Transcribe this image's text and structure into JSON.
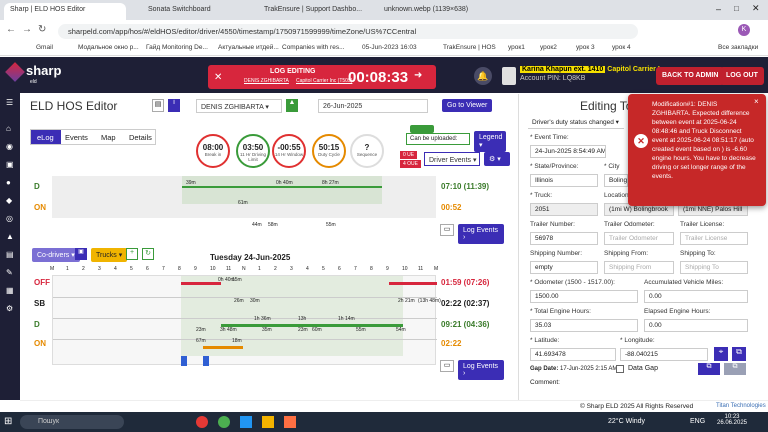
{
  "browser": {
    "tabs": [
      {
        "label": "Sharp | ELD HOS Editor"
      },
      {
        "label": "Sonata Switchboard"
      },
      {
        "label": "TrakEnsure | Support Dashbo..."
      },
      {
        "label": "unknown.webp (1139×638)"
      }
    ],
    "url": "sharpeld.com/app/hos/#/eldHOS/editor/driver/4550/timestamp/1750971599999/timeZone/US%7CCentral",
    "bookmarks": [
      "Gmail",
      "Модальное окно р...",
      "Гайд Monitoring De...",
      "Актуальные итдей...",
      "Companies with res...",
      "05-Jun-2023 16:03",
      "TrakEnsure | HOS",
      "урок1",
      "урок2",
      "урок 3",
      "урок 4",
      "Все закладки"
    ]
  },
  "header": {
    "logo": "sharp",
    "logo_sub": "eld",
    "edit_title": "LOG EDITING",
    "edit_company": "DENIS ZGHIBARTA",
    "edit_carrier": "Capitol Carrier Inc (T505)",
    "timer": "00:08:33",
    "user_highlight": "Karina Khapun ext. 1410",
    "carrier": "Capitol Carrier Inc",
    "account_pin": "Account PIN: LQ8KB",
    "back_admin": "BACK TO ADMIN",
    "logout": "LOG OUT"
  },
  "editor": {
    "title": "ELD HOS Editor",
    "driver": "DENIS ZGHIBARTA",
    "date": "26-Jun-2025",
    "go_viewer": "Go to Viewer",
    "tabs": [
      "eLog",
      "Events",
      "Map",
      "Details"
    ],
    "circles": [
      {
        "value": "08:00",
        "label": "Break in"
      },
      {
        "value": "03:50",
        "label": "11 Hr Driving Limit"
      },
      {
        "value": "-00:55",
        "label": "14 Hr Window"
      },
      {
        "value": "50:15",
        "label": "Duty Cycle"
      },
      {
        "value": "?",
        "label": "Sequence"
      }
    ],
    "can_upload": "Can be uploaded:",
    "legend": "Legend",
    "driver_events": "Driver Events",
    "badges": [
      "0 UE",
      "4 OUE"
    ],
    "top_rows": [
      {
        "label": "D",
        "total": "07:10 (11:39)"
      },
      {
        "label": "ON",
        "total": "00:52"
      }
    ],
    "log_events": "Log Events",
    "co_drivers": "Co-drivers",
    "trucks": "Trucks",
    "day_title": "Tuesday 24-Jun-2025",
    "hours": [
      "M",
      "1",
      "2",
      "3",
      "4",
      "5",
      "6",
      "7",
      "8",
      "9",
      "10",
      "11",
      "N",
      "1",
      "2",
      "3",
      "4",
      "5",
      "6",
      "7",
      "8",
      "9",
      "10",
      "11",
      "M"
    ],
    "rows": [
      {
        "label": "OFF",
        "total": "01:59 (07:26)",
        "color": "#d7263d"
      },
      {
        "label": "SB",
        "total": "02:22 (02:37)",
        "color": "#222"
      },
      {
        "label": "D",
        "total": "09:21 (04:36)",
        "color": "#3a7b2a"
      },
      {
        "label": "ON",
        "total": "02:22",
        "color": "#e58a00"
      }
    ],
    "top_labels": [
      "39m",
      "0h 40m",
      "8h 27m",
      "61m",
      "44m",
      "58m",
      "55m"
    ],
    "mid_labels": [
      "15m",
      "0h 40m",
      "26m",
      "30m",
      "2h 21m",
      "(13h 48m)",
      "1h 36m",
      "13h",
      "1h 14m",
      "23m",
      "3h 48m",
      "35m",
      "23m",
      "60m",
      "67m",
      "18m",
      "55m",
      "54m"
    ]
  },
  "panel": {
    "title": "Editing To",
    "status": "Driver's duty status changed",
    "event_time_label": "* Event Time:",
    "event_time": "24-Jun-2025 8:54:49 AM",
    "state_label": "* State/Province:",
    "state": "Illinois",
    "city_label": "* City",
    "city": "Boling",
    "truck_label": "* Truck:",
    "truck": "2051",
    "location_label": "Location",
    "location": "(1mi W) Bolingbrook",
    "location2": "(1mi NNE) Palos Hill",
    "trailer_number_label": "Trailer Number:",
    "trailer_number": "56978",
    "trailer_odometer_label": "Trailer Odometer:",
    "trailer_odometer_ph": "Trailer Odometer",
    "trailer_license_label": "Trailer License:",
    "trailer_license_ph": "Trailer License",
    "shipping_number_label": "Shipping Number:",
    "shipping_number": "empty",
    "shipping_from_label": "Shipping From:",
    "shipping_from_ph": "Shipping From",
    "shipping_to_label": "Shipping To:",
    "shipping_to_ph": "Shipping To",
    "odometer_label": "* Odometer (1500 - 1517.00):",
    "odometer": "1500.00",
    "acc_miles_label": "Accumulated Vehicle Miles:",
    "acc_miles": "0.00",
    "engine_hours_label": "* Total Engine Hours:",
    "engine_hours": "35.03",
    "elapsed_label": "Elapsed Engine Hours:",
    "elapsed": "0.00",
    "lat_label": "* Latitude:",
    "lat": "41.693478",
    "lon_label": "* Longitude:",
    "lon": "-88.040215",
    "gap_label": "Gap Date:",
    "gap_date": "17-Jun-2025 2:15 AM",
    "data_gap": "Data Gap",
    "comment_label": "Comment:"
  },
  "toast": {
    "text": "Modification#1: DENIS ZGHIBARTA. Expected difference between event at 2025-06-24 08:48:46 and Truck Disconnect event at 2025-06-24 08:51:17 (auto created event based on ) is -6.60 engine hours. You have to decrease driving or set longer range of the events.",
    "color": "#c62828"
  },
  "footer": {
    "copy": "© Sharp ELD  2025 All Rights Reserved",
    "brand": "Titan Technologies"
  },
  "taskbar": {
    "search": "Пошук",
    "weather": "22°C  Windy",
    "lang": "ENG",
    "time": "10:23",
    "date": "26.06.2025"
  }
}
